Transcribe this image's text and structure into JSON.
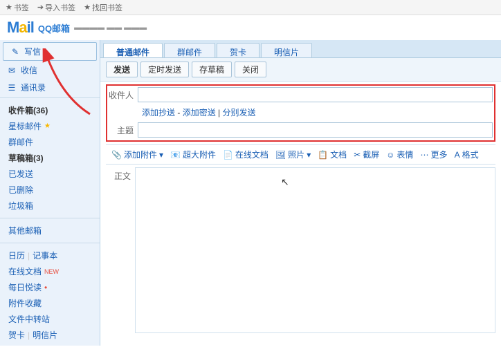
{
  "topbar": {
    "bookmark": "书签",
    "import": "导入书签",
    "find": "找回书签"
  },
  "header": {
    "brand": "QQ邮箱"
  },
  "sidebar": {
    "compose": "写信",
    "receive": "收信",
    "contacts": "通讯录",
    "inbox": "收件箱(36)",
    "starred": "星标邮件",
    "group": "群邮件",
    "drafts": "草稿箱(3)",
    "sent": "已发送",
    "deleted": "已删除",
    "spam": "垃圾箱",
    "other_mail": "其他邮箱",
    "calendar": "日历",
    "memo": "记事本",
    "online_doc": "在线文档",
    "daily_read": "每日悦读",
    "attach_collect": "附件收藏",
    "file_transfer": "文件中转站",
    "card": "贺卡",
    "postcard": "明信片"
  },
  "tabs": {
    "normal": "普通邮件",
    "group": "群邮件",
    "card": "贺卡",
    "postcard": "明信片"
  },
  "actions": {
    "send": "发送",
    "timed": "定时发送",
    "draft": "存草稿",
    "close": "关闭"
  },
  "compose": {
    "to_label": "收件人",
    "add_cc": "添加抄送",
    "add_bcc": "添加密送",
    "sep_send": "分别发送",
    "subject_label": "主题",
    "body_label": "正文"
  },
  "toolbar": {
    "attach": "添加附件",
    "big_attach": "超大附件",
    "online_doc": "在线文档",
    "photo": "照片",
    "doc": "文档",
    "screenshot": "截屏",
    "emoji": "表情",
    "more": "更多",
    "format": "格式"
  }
}
